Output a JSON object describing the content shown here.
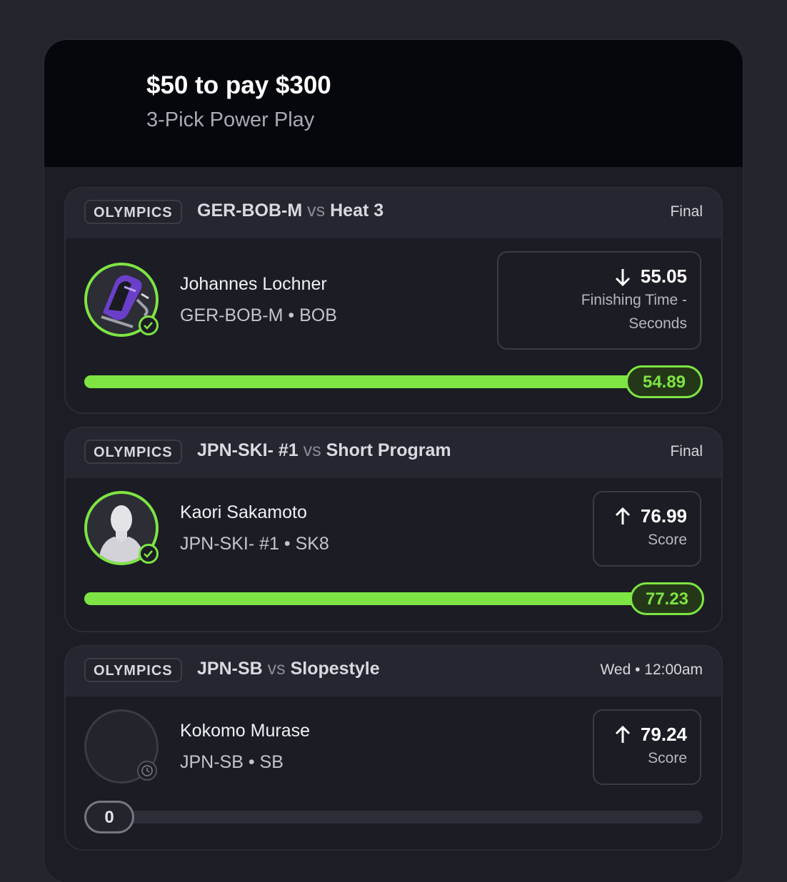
{
  "header": {
    "payout": "$50 to pay $300",
    "play_type": "3-Pick Power Play"
  },
  "picks": [
    {
      "league": "OLYMPICS",
      "team": "GER-BOB-M",
      "vs": "vs",
      "opponent": "Heat 3",
      "status": "Final",
      "player": "Johannes Lochner",
      "subtitle": "GER-BOB-M • BOB",
      "direction": "down",
      "line": "55.05",
      "stat_lines": [
        "Finishing Time -",
        "Seconds"
      ],
      "result": "54.89",
      "progress": 1.0,
      "state": "won",
      "avatar_icon": "bobsled-icon"
    },
    {
      "league": "OLYMPICS",
      "team": "JPN-SKI- #1",
      "vs": "vs",
      "opponent": "Short Program",
      "status": "Final",
      "player": "Kaori Sakamoto",
      "subtitle": "JPN-SKI- #1 • SK8",
      "direction": "up",
      "line": "76.99",
      "stat_lines": [
        "Score"
      ],
      "result": "77.23",
      "progress": 1.0,
      "state": "won",
      "avatar_icon": "person-silhouette-icon"
    },
    {
      "league": "OLYMPICS",
      "team": "JPN-SB",
      "vs": "vs",
      "opponent": "Slopestyle",
      "status": "Wed • 12:00am",
      "player": "Kokomo Murase",
      "subtitle": "JPN-SB • SB",
      "direction": "up",
      "line": "79.24",
      "stat_lines": [
        "Score"
      ],
      "result": "0",
      "progress": 0.0,
      "state": "pending",
      "avatar_icon": "clock-icon"
    }
  ],
  "colors": {
    "accent": "#7ee443",
    "background": "#24252d",
    "card": "#1b1c24",
    "header": "#05070d"
  }
}
